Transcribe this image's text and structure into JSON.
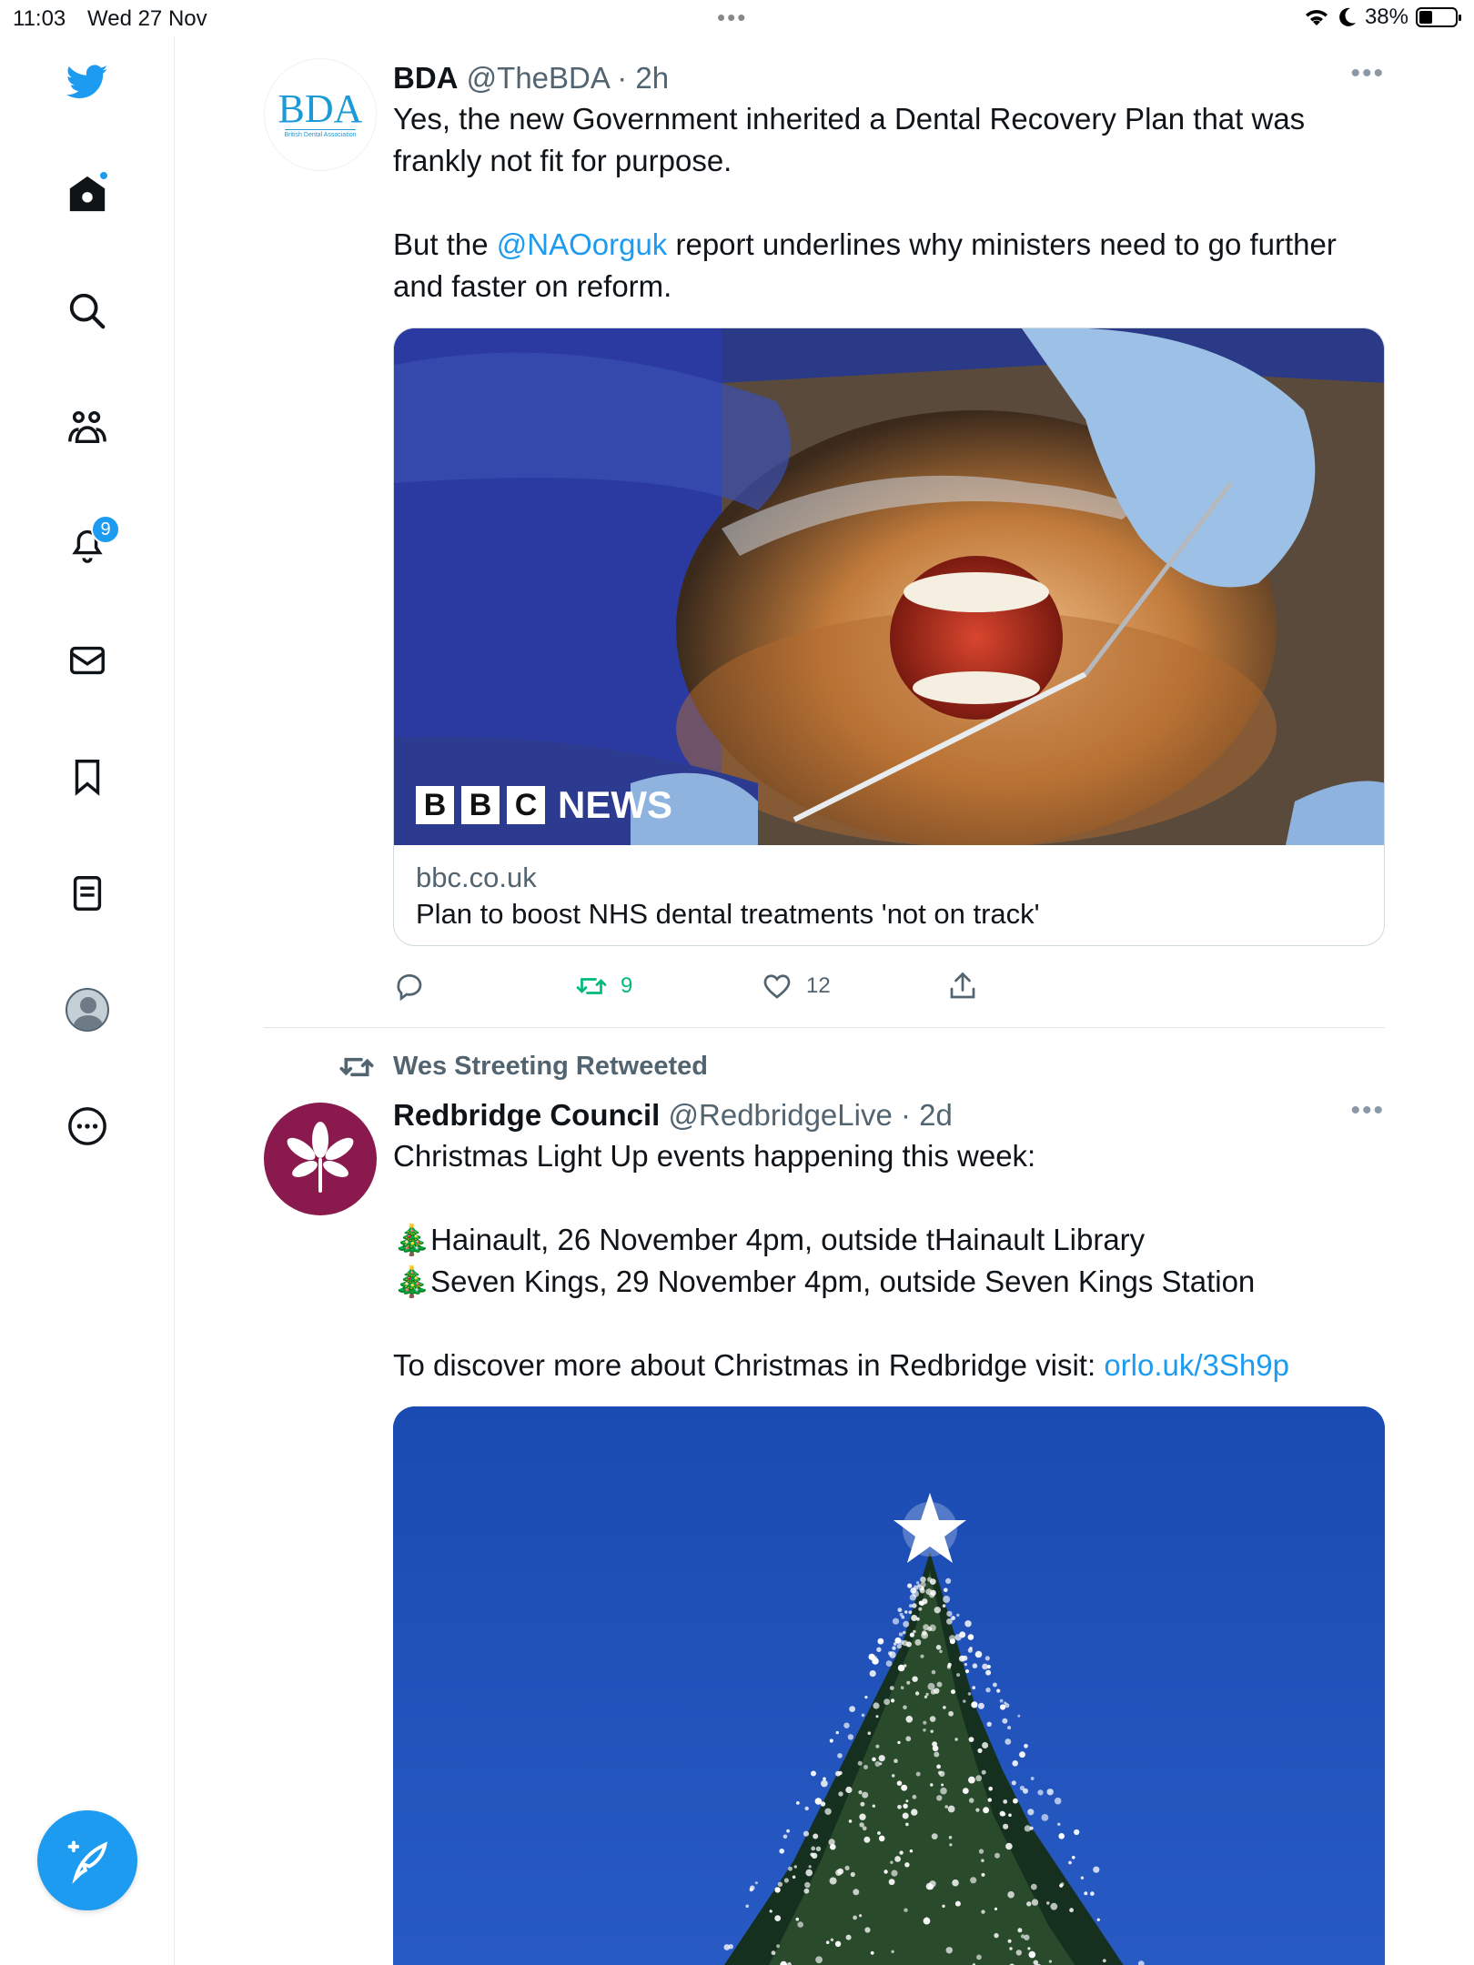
{
  "status_bar": {
    "time": "11:03",
    "date": "Wed 27 Nov",
    "battery": "38%",
    "battery_level": 0.38
  },
  "sidebar": {
    "notifications_badge": "9",
    "icons": [
      "twitter-bird-icon",
      "home-icon",
      "search-icon",
      "communities-icon",
      "notifications-icon",
      "messages-icon",
      "bookmarks-icon",
      "lists-icon",
      "profile-icon",
      "more-icon",
      "compose-icon"
    ]
  },
  "tweets": [
    {
      "name": "BDA",
      "handle": "@TheBDA",
      "time": "2h",
      "avatar_logo": "BDA",
      "avatar_sub": "British Dental Association",
      "text": {
        "line1": "Yes, the new Government inherited a Dental Recovery Plan that was frankly not fit for purpose.",
        "line2_pre": "But the ",
        "line2_link": "@NAOorguk",
        "line2_post": " report underlines why ministers need to go further and faster on reform."
      },
      "card": {
        "media_label": "NEWS",
        "media_letters": [
          "B",
          "B",
          "C"
        ],
        "domain": "bbc.co.uk",
        "title": "Plan to boost NHS dental treatments 'not on track'"
      },
      "actions": {
        "reply": "",
        "retweets": "9",
        "likes": "12"
      }
    },
    {
      "retweeted_by": "Wes Streeting Retweeted",
      "name": "Redbridge Council",
      "handle": "@RedbridgeLive",
      "time": "2d",
      "text": {
        "line1": "Christmas Light Up events happening this week:",
        "item1": "🎄Hainault, 26 November 4pm, outside tHainault Library",
        "item2": "🎄Seven Kings, 29 November 4pm, outside Seven Kings Station",
        "line3_pre": "To discover more about Christmas in Redbridge visit: ",
        "line3_link": "orlo.uk/3Sh9p"
      }
    }
  ],
  "colors": {
    "accent": "#1d9bf0",
    "retweet_green": "#00ba7c",
    "secondary_text": "#536471",
    "council_brand": "#8a1a4e"
  }
}
